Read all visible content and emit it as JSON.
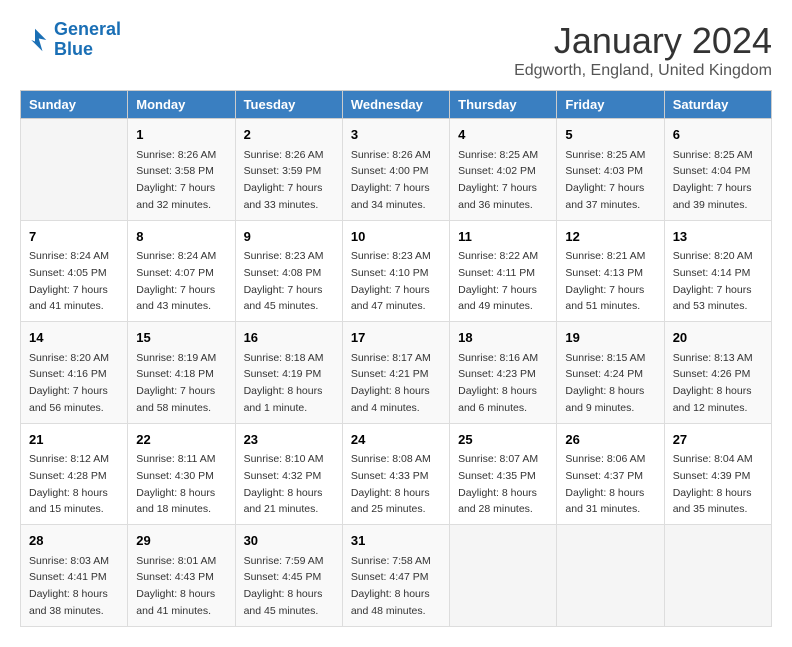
{
  "header": {
    "logo_line1": "General",
    "logo_line2": "Blue",
    "month_title": "January 2024",
    "location": "Edgworth, England, United Kingdom"
  },
  "weekdays": [
    "Sunday",
    "Monday",
    "Tuesday",
    "Wednesday",
    "Thursday",
    "Friday",
    "Saturday"
  ],
  "weeks": [
    [
      {
        "day": "",
        "sunrise": "",
        "sunset": "",
        "daylight": ""
      },
      {
        "day": "1",
        "sunrise": "Sunrise: 8:26 AM",
        "sunset": "Sunset: 3:58 PM",
        "daylight": "Daylight: 7 hours and 32 minutes."
      },
      {
        "day": "2",
        "sunrise": "Sunrise: 8:26 AM",
        "sunset": "Sunset: 3:59 PM",
        "daylight": "Daylight: 7 hours and 33 minutes."
      },
      {
        "day": "3",
        "sunrise": "Sunrise: 8:26 AM",
        "sunset": "Sunset: 4:00 PM",
        "daylight": "Daylight: 7 hours and 34 minutes."
      },
      {
        "day": "4",
        "sunrise": "Sunrise: 8:25 AM",
        "sunset": "Sunset: 4:02 PM",
        "daylight": "Daylight: 7 hours and 36 minutes."
      },
      {
        "day": "5",
        "sunrise": "Sunrise: 8:25 AM",
        "sunset": "Sunset: 4:03 PM",
        "daylight": "Daylight: 7 hours and 37 minutes."
      },
      {
        "day": "6",
        "sunrise": "Sunrise: 8:25 AM",
        "sunset": "Sunset: 4:04 PM",
        "daylight": "Daylight: 7 hours and 39 minutes."
      }
    ],
    [
      {
        "day": "7",
        "sunrise": "Sunrise: 8:24 AM",
        "sunset": "Sunset: 4:05 PM",
        "daylight": "Daylight: 7 hours and 41 minutes."
      },
      {
        "day": "8",
        "sunrise": "Sunrise: 8:24 AM",
        "sunset": "Sunset: 4:07 PM",
        "daylight": "Daylight: 7 hours and 43 minutes."
      },
      {
        "day": "9",
        "sunrise": "Sunrise: 8:23 AM",
        "sunset": "Sunset: 4:08 PM",
        "daylight": "Daylight: 7 hours and 45 minutes."
      },
      {
        "day": "10",
        "sunrise": "Sunrise: 8:23 AM",
        "sunset": "Sunset: 4:10 PM",
        "daylight": "Daylight: 7 hours and 47 minutes."
      },
      {
        "day": "11",
        "sunrise": "Sunrise: 8:22 AM",
        "sunset": "Sunset: 4:11 PM",
        "daylight": "Daylight: 7 hours and 49 minutes."
      },
      {
        "day": "12",
        "sunrise": "Sunrise: 8:21 AM",
        "sunset": "Sunset: 4:13 PM",
        "daylight": "Daylight: 7 hours and 51 minutes."
      },
      {
        "day": "13",
        "sunrise": "Sunrise: 8:20 AM",
        "sunset": "Sunset: 4:14 PM",
        "daylight": "Daylight: 7 hours and 53 minutes."
      }
    ],
    [
      {
        "day": "14",
        "sunrise": "Sunrise: 8:20 AM",
        "sunset": "Sunset: 4:16 PM",
        "daylight": "Daylight: 7 hours and 56 minutes."
      },
      {
        "day": "15",
        "sunrise": "Sunrise: 8:19 AM",
        "sunset": "Sunset: 4:18 PM",
        "daylight": "Daylight: 7 hours and 58 minutes."
      },
      {
        "day": "16",
        "sunrise": "Sunrise: 8:18 AM",
        "sunset": "Sunset: 4:19 PM",
        "daylight": "Daylight: 8 hours and 1 minute."
      },
      {
        "day": "17",
        "sunrise": "Sunrise: 8:17 AM",
        "sunset": "Sunset: 4:21 PM",
        "daylight": "Daylight: 8 hours and 4 minutes."
      },
      {
        "day": "18",
        "sunrise": "Sunrise: 8:16 AM",
        "sunset": "Sunset: 4:23 PM",
        "daylight": "Daylight: 8 hours and 6 minutes."
      },
      {
        "day": "19",
        "sunrise": "Sunrise: 8:15 AM",
        "sunset": "Sunset: 4:24 PM",
        "daylight": "Daylight: 8 hours and 9 minutes."
      },
      {
        "day": "20",
        "sunrise": "Sunrise: 8:13 AM",
        "sunset": "Sunset: 4:26 PM",
        "daylight": "Daylight: 8 hours and 12 minutes."
      }
    ],
    [
      {
        "day": "21",
        "sunrise": "Sunrise: 8:12 AM",
        "sunset": "Sunset: 4:28 PM",
        "daylight": "Daylight: 8 hours and 15 minutes."
      },
      {
        "day": "22",
        "sunrise": "Sunrise: 8:11 AM",
        "sunset": "Sunset: 4:30 PM",
        "daylight": "Daylight: 8 hours and 18 minutes."
      },
      {
        "day": "23",
        "sunrise": "Sunrise: 8:10 AM",
        "sunset": "Sunset: 4:32 PM",
        "daylight": "Daylight: 8 hours and 21 minutes."
      },
      {
        "day": "24",
        "sunrise": "Sunrise: 8:08 AM",
        "sunset": "Sunset: 4:33 PM",
        "daylight": "Daylight: 8 hours and 25 minutes."
      },
      {
        "day": "25",
        "sunrise": "Sunrise: 8:07 AM",
        "sunset": "Sunset: 4:35 PM",
        "daylight": "Daylight: 8 hours and 28 minutes."
      },
      {
        "day": "26",
        "sunrise": "Sunrise: 8:06 AM",
        "sunset": "Sunset: 4:37 PM",
        "daylight": "Daylight: 8 hours and 31 minutes."
      },
      {
        "day": "27",
        "sunrise": "Sunrise: 8:04 AM",
        "sunset": "Sunset: 4:39 PM",
        "daylight": "Daylight: 8 hours and 35 minutes."
      }
    ],
    [
      {
        "day": "28",
        "sunrise": "Sunrise: 8:03 AM",
        "sunset": "Sunset: 4:41 PM",
        "daylight": "Daylight: 8 hours and 38 minutes."
      },
      {
        "day": "29",
        "sunrise": "Sunrise: 8:01 AM",
        "sunset": "Sunset: 4:43 PM",
        "daylight": "Daylight: 8 hours and 41 minutes."
      },
      {
        "day": "30",
        "sunrise": "Sunrise: 7:59 AM",
        "sunset": "Sunset: 4:45 PM",
        "daylight": "Daylight: 8 hours and 45 minutes."
      },
      {
        "day": "31",
        "sunrise": "Sunrise: 7:58 AM",
        "sunset": "Sunset: 4:47 PM",
        "daylight": "Daylight: 8 hours and 48 minutes."
      },
      {
        "day": "",
        "sunrise": "",
        "sunset": "",
        "daylight": ""
      },
      {
        "day": "",
        "sunrise": "",
        "sunset": "",
        "daylight": ""
      },
      {
        "day": "",
        "sunrise": "",
        "sunset": "",
        "daylight": ""
      }
    ]
  ]
}
